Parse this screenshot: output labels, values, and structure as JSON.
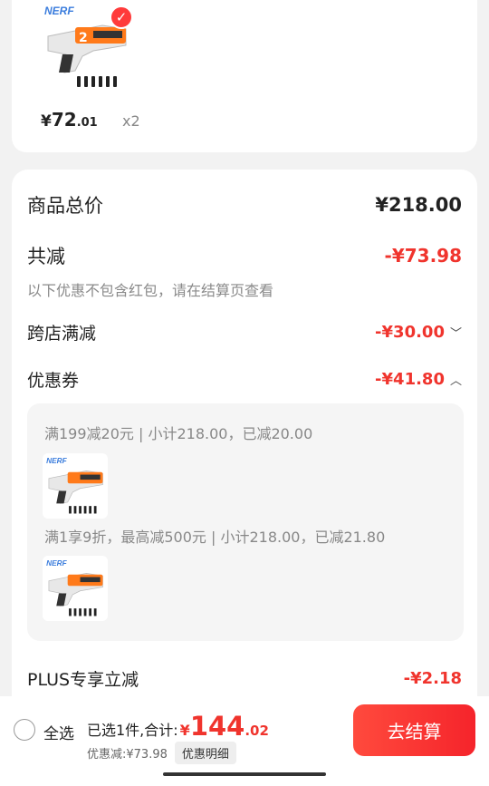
{
  "product": {
    "brand": "NERF",
    "price_symbol": "¥",
    "price_int": "72",
    "price_dec": ".01",
    "quantity": "x2"
  },
  "summary": {
    "goods_total_label": "商品总价",
    "goods_total_value": "¥218.00",
    "total_reduction_label": "共减",
    "total_reduction_value": "-¥73.98",
    "reduction_note": "以下优惠不包含红包，请在结算页查看",
    "cross_store_label": "跨店满减",
    "cross_store_value": "-¥30.00",
    "coupon_label": "优惠券",
    "coupon_value": "-¥41.80",
    "coupon_details": [
      {
        "text": "满199减20元 | 小计218.00，已减20.00"
      },
      {
        "text": "满1享9折，最高减500元 | 小计218.00，已减21.80"
      }
    ],
    "plus_label": "PLUS专享立减",
    "plus_value": "-¥2.18"
  },
  "bottom_bar": {
    "select_all": "全选",
    "selected_total_label": "已选1件,合计:",
    "total_symbol": "¥",
    "total_int": "144",
    "total_dec": ".02",
    "discount_text": "优惠减:¥73.98",
    "detail_button": "优惠明细",
    "checkout_button": "去结算"
  },
  "colors": {
    "accent_red": "#f0342d",
    "checkout_gradient_start": "#ff4a3d",
    "checkout_gradient_end": "#f5242b"
  }
}
